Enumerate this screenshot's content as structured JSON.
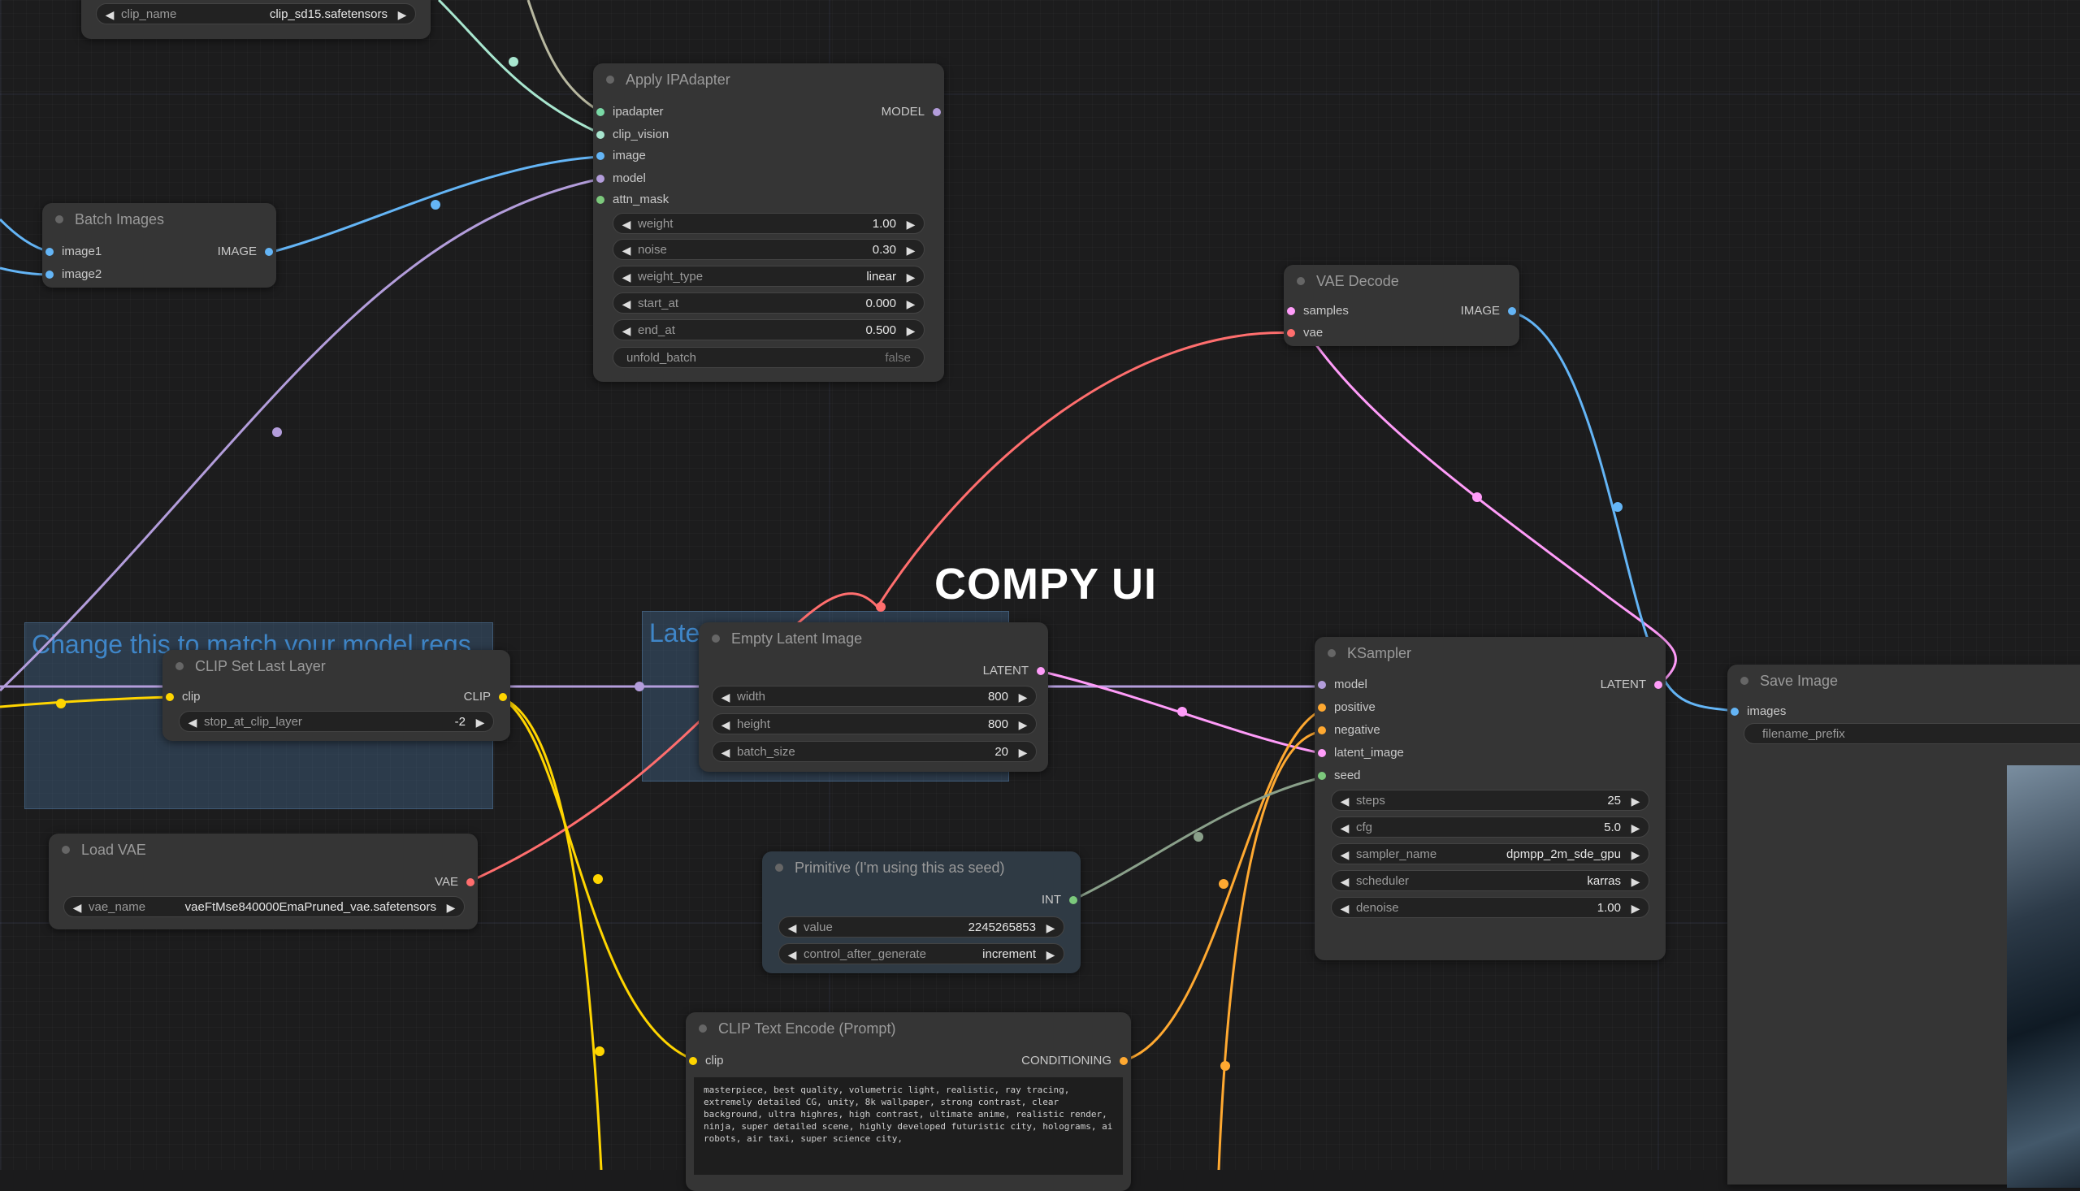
{
  "overlay_title": "COMPY UI",
  "top_widget": {
    "name": "clip_name",
    "value": "clip_sd15.safetensors"
  },
  "groups": {
    "left": "Change this to match your model reqs",
    "middle": "Late"
  },
  "nodes": {
    "apply_ipadapter": {
      "title": "Apply IPAdapter",
      "inputs": [
        "ipadapter",
        "clip_vision",
        "image",
        "model",
        "attn_mask"
      ],
      "output": "MODEL",
      "widgets": [
        {
          "name": "weight",
          "value": "1.00"
        },
        {
          "name": "noise",
          "value": "0.30"
        },
        {
          "name": "weight_type",
          "value": "linear"
        },
        {
          "name": "start_at",
          "value": "0.000"
        },
        {
          "name": "end_at",
          "value": "0.500"
        }
      ],
      "toggle": {
        "name": "unfold_batch",
        "value": "false"
      }
    },
    "batch_images": {
      "title": "Batch Images",
      "inputs": [
        "image1",
        "image2"
      ],
      "output": "IMAGE"
    },
    "vae_decode": {
      "title": "VAE Decode",
      "inputs": [
        "samples",
        "vae"
      ],
      "output": "IMAGE"
    },
    "clip_set_last_layer": {
      "title": "CLIP Set Last Layer",
      "input": "clip",
      "output": "CLIP",
      "widget": {
        "name": "stop_at_clip_layer",
        "value": "-2"
      }
    },
    "empty_latent": {
      "title": "Empty Latent Image",
      "output": "LATENT",
      "widgets": [
        {
          "name": "width",
          "value": "800"
        },
        {
          "name": "height",
          "value": "800"
        },
        {
          "name": "batch_size",
          "value": "20"
        }
      ]
    },
    "ksampler": {
      "title": "KSampler",
      "inputs": [
        "model",
        "positive",
        "negative",
        "latent_image",
        "seed"
      ],
      "output": "LATENT",
      "widgets": [
        {
          "name": "steps",
          "value": "25"
        },
        {
          "name": "cfg",
          "value": "5.0"
        },
        {
          "name": "sampler_name",
          "value": "dpmpp_2m_sde_gpu"
        },
        {
          "name": "scheduler",
          "value": "karras"
        },
        {
          "name": "denoise",
          "value": "1.00"
        }
      ]
    },
    "save_image": {
      "title": "Save Image",
      "input": "images",
      "widget": {
        "name": "filename_prefix"
      }
    },
    "load_vae": {
      "title": "Load VAE",
      "output": "VAE",
      "widget": {
        "name": "vae_name",
        "value": "vaeFtMse840000EmaPruned_vae.safetensors"
      }
    },
    "primitive": {
      "title": "Primitive (I'm using this as seed)",
      "output": "INT",
      "widgets": [
        {
          "name": "value",
          "value": "2245265853"
        },
        {
          "name": "control_after_generate",
          "value": "increment"
        }
      ]
    },
    "clip_text_encode": {
      "title": "CLIP Text Encode (Prompt)",
      "input": "clip",
      "output": "CONDITIONING",
      "text": "masterpiece, best quality, volumetric light, realistic, ray tracing, extremely detailed CG, unity, 8k wallpaper, strong contrast, clear background, ultra highres, high contrast, ultimate anime, realistic render, ninja, super detailed scene, highly developed futuristic city, holograms, ai robots, air taxi, super science city,"
    }
  },
  "colors": {
    "model_wire": "#b39ddb",
    "image_wire": "#64b5f6",
    "vae_wire": "#ff6e6e",
    "latent_wire": "#ff9cf9",
    "clip_wire": "#ffd500",
    "conditioning_wire": "#ffa931",
    "int_wire": "#8aa08a",
    "ipadapter_wire": "#7ad9a6"
  }
}
